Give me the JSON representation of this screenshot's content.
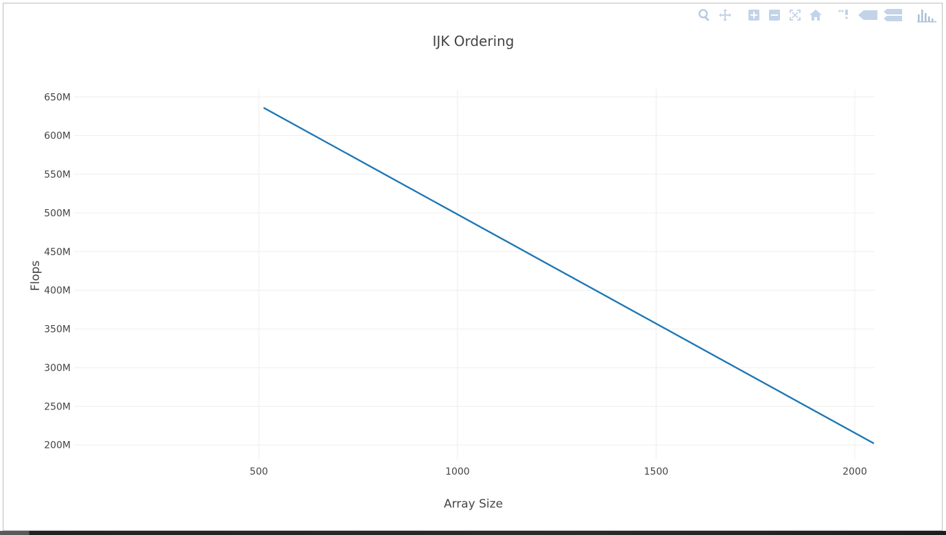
{
  "colors": {
    "line": "#1f77b4",
    "grid": "#eeeeee",
    "text": "#444444",
    "modebar_icon": "#c3d3e8",
    "modebar_icon_dark": "#a9bfd9"
  },
  "modebar": {
    "icons": [
      "zoom-icon",
      "pan-icon",
      "zoom-in-icon",
      "zoom-out-icon",
      "autoscale-icon",
      "reset-axes-icon",
      "spike-lines-icon",
      "hover-closest-icon",
      "hover-compare-icon",
      "plotly-logo-icon"
    ]
  },
  "chart_data": {
    "type": "line",
    "title": "IJK Ordering",
    "xlabel": "Array Size",
    "ylabel": "Flops",
    "x": [
      512,
      2048
    ],
    "series": [
      {
        "values": [
          636000000,
          202000000
        ]
      }
    ],
    "xlim": [
      35,
      2050
    ],
    "ylim": [
      190000000,
      660000000
    ],
    "xticks": [
      500,
      1000,
      1500,
      2000
    ],
    "xtick_labels": [
      "500",
      "1000",
      "1500",
      "2000"
    ],
    "yticks": [
      200000000,
      250000000,
      300000000,
      350000000,
      400000000,
      450000000,
      500000000,
      550000000,
      600000000,
      650000000
    ],
    "ytick_labels": [
      "200M",
      "250M",
      "300M",
      "350M",
      "400M",
      "450M",
      "500M",
      "550M",
      "600M",
      "650M"
    ],
    "grid": true,
    "legend": "none"
  }
}
